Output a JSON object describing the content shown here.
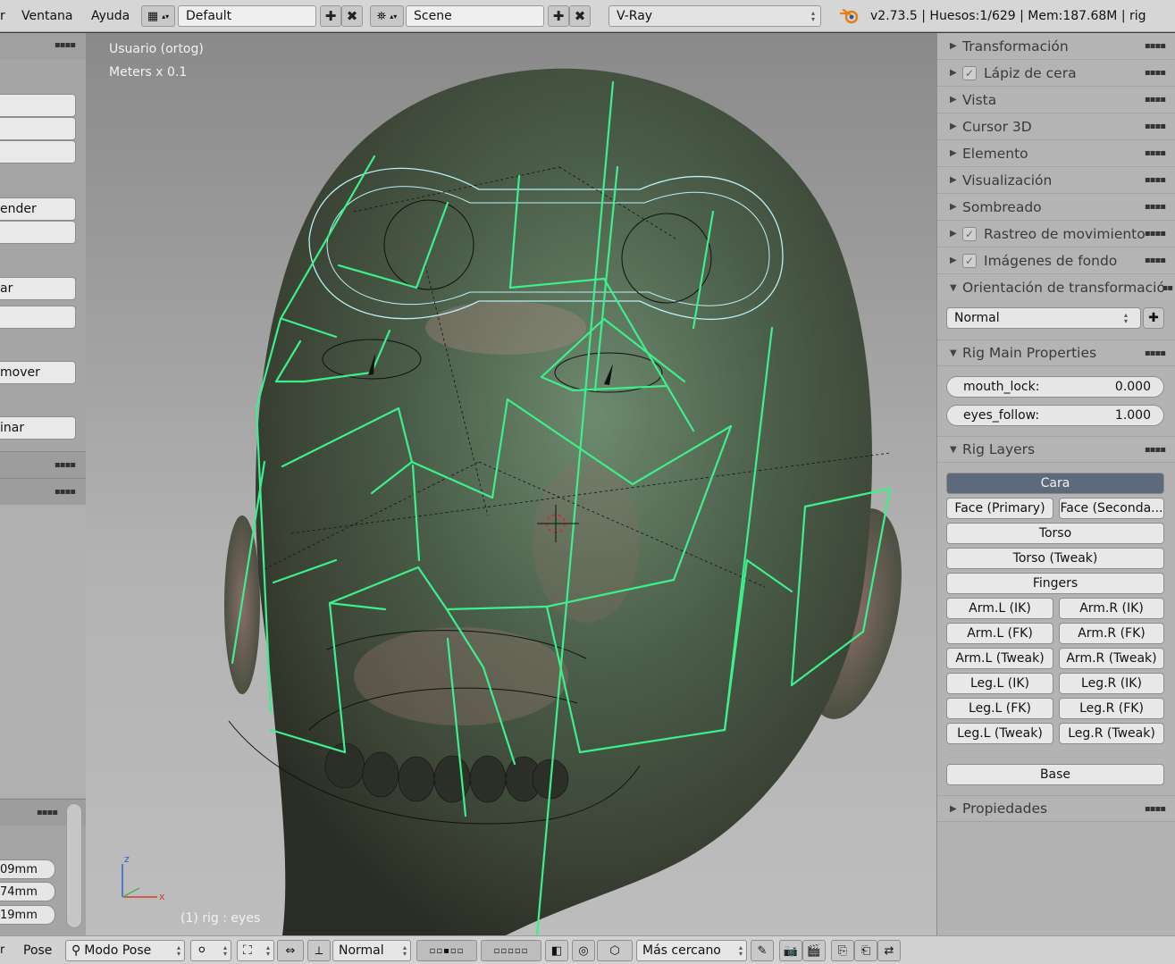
{
  "menu": {
    "window": "Ventana",
    "help": "Ayuda"
  },
  "screen_layout": {
    "value": "Default"
  },
  "scene": {
    "value": "Scene"
  },
  "render_engine": {
    "value": "V-Ray"
  },
  "stats": {
    "text": "v2.73.5 | Huesos:1/629  | Mem:187.68M | rig"
  },
  "left_panel": {
    "buttons": [
      "ender",
      "ar",
      "mover",
      "inar"
    ],
    "values": [
      "09mm",
      "74mm",
      "19mm"
    ]
  },
  "viewport": {
    "view_name": "Usuario (ortog)",
    "units": "Meters x 0.1",
    "selection": "(1) rig : eyes",
    "axes": {
      "z": "z",
      "x": "x"
    }
  },
  "right_panel": {
    "sections": {
      "transform": "Transformación",
      "grease_pencil": "Lápiz de cera",
      "view": "Vista",
      "cursor": "Cursor 3D",
      "item": "Elemento",
      "display": "Visualización",
      "shading": "Sombreado",
      "motion_tracking": "Rastreo de movimiento",
      "background_images": "Imágenes de fondo",
      "transform_orientation": "Orientación de transformación",
      "rig_main": "Rig Main Properties",
      "rig_layers": "Rig Layers",
      "properties": "Propiedades"
    },
    "orientation_value": "Normal",
    "props": [
      {
        "name": "mouth_lock:",
        "value": "0.000"
      },
      {
        "name": "eyes_follow:",
        "value": "1.000"
      }
    ],
    "layers": {
      "cara": "Cara",
      "face_primary": "Face (Primary)",
      "face_secondary": "Face (Seconda...",
      "torso": "Torso",
      "torso_tweak": "Torso (Tweak)",
      "fingers": "Fingers",
      "arm_l_ik": "Arm.L (IK)",
      "arm_r_ik": "Arm.R (IK)",
      "arm_l_fk": "Arm.L (FK)",
      "arm_r_fk": "Arm.R (FK)",
      "arm_l_tweak": "Arm.L (Tweak)",
      "arm_r_tweak": "Arm.R (Tweak)",
      "leg_l_ik": "Leg.L (IK)",
      "leg_r_ik": "Leg.R (IK)",
      "leg_l_fk": "Leg.L (FK)",
      "leg_r_fk": "Leg.R (FK)",
      "leg_l_tweak": "Leg.L (Tweak)",
      "leg_r_tweak": "Leg.R (Tweak)",
      "base": "Base"
    }
  },
  "bottom_bar": {
    "pose_menu": "Pose",
    "mode": "Modo Pose",
    "pivot_orientation": "Normal",
    "snap_target": "Más cercano"
  },
  "colors": {
    "bone": "#3cf08a",
    "active_layer": "#5c6a7b",
    "widget": "#b8f0f5"
  }
}
